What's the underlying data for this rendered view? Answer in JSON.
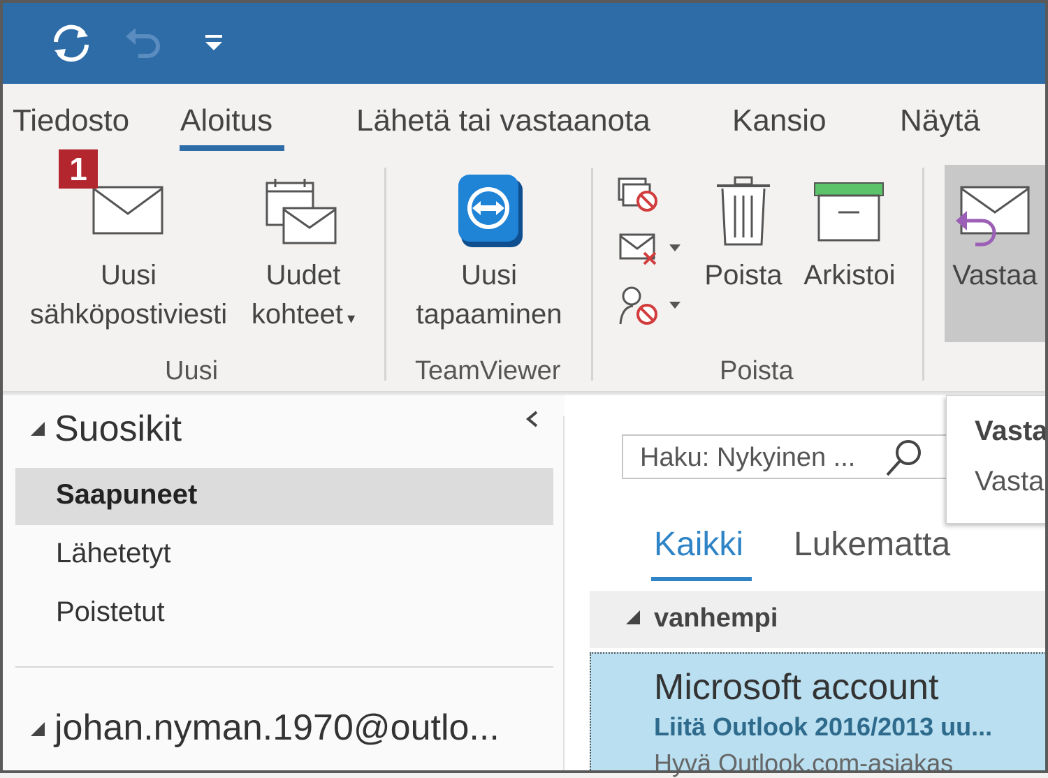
{
  "quick_access": {
    "sync_icon": "sync-icon",
    "undo_icon": "undo-icon",
    "customize_icon": "customize-quick-access-icon"
  },
  "tabs": [
    {
      "label": "Tiedosto"
    },
    {
      "label": "Aloitus",
      "active": true
    },
    {
      "label": "Lähetä tai vastaanota"
    },
    {
      "label": "Kansio"
    },
    {
      "label": "Näytä"
    }
  ],
  "ribbon": {
    "badge": "1",
    "new_email": {
      "line1": "Uusi",
      "line2": "sähköpostiviesti"
    },
    "new_items": {
      "line1": "Uudet",
      "line2": "kohteet"
    },
    "group_new": "Uusi",
    "new_meeting": {
      "line1": "Uusi",
      "line2": "tapaaminen"
    },
    "group_teamviewer": "TeamViewer",
    "delete": "Poista",
    "archive": "Arkistoi",
    "group_delete": "Poista",
    "reply": "Vastaa"
  },
  "folders": {
    "favorites": "Suosikit",
    "items": [
      {
        "label": "Saapuneet",
        "selected": true
      },
      {
        "label": "Lähetetyt"
      },
      {
        "label": "Poistetut"
      }
    ],
    "account": "johan.nyman.1970@outlo..."
  },
  "messages": {
    "search_placeholder": "Haku: Nykyinen ...",
    "filter_all": "Kaikki",
    "filter_unread": "Lukematta",
    "group": "vanhempi",
    "item": {
      "sender": "Microsoft account",
      "subject": "Liitä Outlook 2016/2013 uu...",
      "preview": "Hyvä Outlook.com-asiakas"
    }
  },
  "reply_popup": {
    "line1": "Vasta",
    "line2": "Vasta"
  },
  "colors": {
    "accent": "#2e6ca7",
    "link": "#2e84c6",
    "selected_message": "#b9dff0",
    "badge": "#b3262d"
  }
}
